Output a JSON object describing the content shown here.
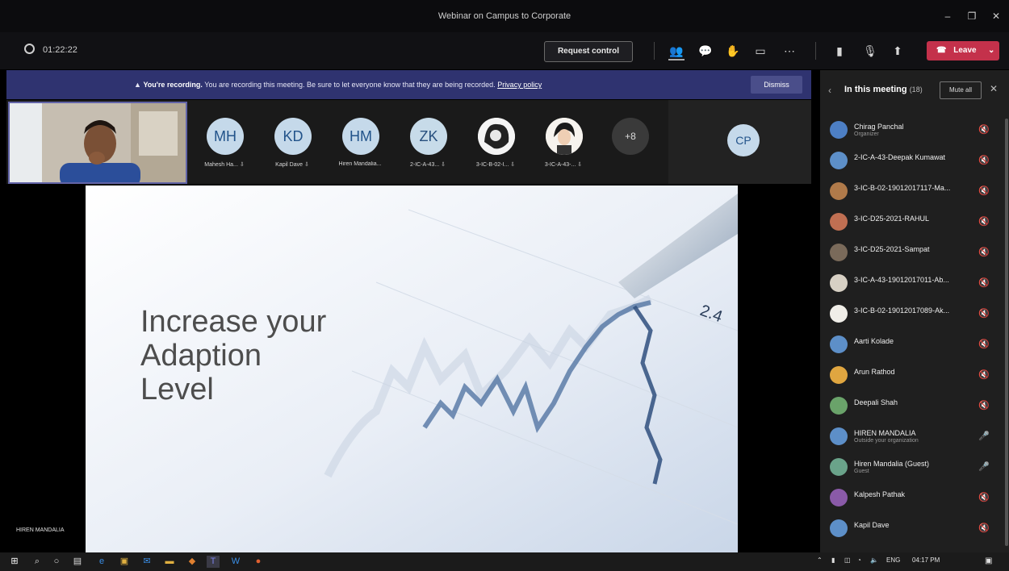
{
  "window": {
    "title": "Webinar on Campus to Corporate",
    "controls": [
      "–",
      "❐",
      "✕"
    ]
  },
  "toolbar": {
    "timer": "01:22:22",
    "request_control": "Request control",
    "leave": "Leave"
  },
  "banner": {
    "lead": "You're recording.",
    "message": "You are recording this meeting. Be sure to let everyone know that they are being recorded.",
    "link": "Privacy policy",
    "dismiss": "Dismiss"
  },
  "strip": {
    "avatars": [
      {
        "initials": "MH",
        "name": "Mahesh Ha... ⇩"
      },
      {
        "initials": "KD",
        "name": "Kapil Dave ⇩"
      },
      {
        "initials": "HM",
        "name": "Hiren Mandalia..."
      },
      {
        "initials": "ZK",
        "name": "2-IC-A-43... ⇩"
      },
      {
        "initials": "",
        "name": "3-IC-B-02-I... ⇩"
      },
      {
        "initials": "",
        "name": "3-IC-A-43-... ⇩"
      }
    ],
    "overflow": "+8",
    "cp_initials": "CP"
  },
  "slide": {
    "title": "Increase your\nAdaption\nLevel"
  },
  "presenter_label": "HIREN MANDALIA",
  "panel": {
    "title": "In this meeting",
    "count": "(18)",
    "mute_all": "Mute all",
    "participants": [
      {
        "name": "Chirag Panchal",
        "sub": "Organizer",
        "color": "#4d7fc4",
        "mic": "🔇"
      },
      {
        "name": "2-IC-A-43-Deepak Kumawat",
        "sub": "",
        "color": "#5d8fc8",
        "mic": "🔇"
      },
      {
        "name": "3-IC-B-02-19012017117-Ma...",
        "sub": "",
        "color": "#b07a4a",
        "mic": "🔇"
      },
      {
        "name": "3-IC-D25-2021-RAHUL",
        "sub": "",
        "color": "#c06f52",
        "mic": "🔇"
      },
      {
        "name": "3-IC-D25-2021-Sampat",
        "sub": "",
        "color": "#7a6a5a",
        "mic": "🔇"
      },
      {
        "name": "3-IC-A-43-19012017011-Ab...",
        "sub": "",
        "color": "#d7d0c4",
        "mic": "🔇"
      },
      {
        "name": "3-IC-B-02-19012017089-Ak...",
        "sub": "",
        "color": "#f0eee8",
        "mic": "🔇"
      },
      {
        "name": "Aarti Kolade",
        "sub": "",
        "color": "#5d8fc8",
        "mic": "🔇"
      },
      {
        "name": "Arun Rathod",
        "sub": "",
        "color": "#e0a640",
        "mic": "🔇"
      },
      {
        "name": "Deepali Shah",
        "sub": "",
        "color": "#6aa36a",
        "mic": "🔇"
      },
      {
        "name": "HIREN MANDALIA",
        "sub": "Outside your organization",
        "color": "#5d8fc8",
        "mic": "🎤"
      },
      {
        "name": "Hiren Mandalia (Guest)",
        "sub": "Guest",
        "color": "#6aa38a",
        "mic": "🎤"
      },
      {
        "name": "Kalpesh Pathak",
        "sub": "",
        "color": "#8a5aa8",
        "mic": "🔇"
      },
      {
        "name": "Kapil Dave",
        "sub": "",
        "color": "#5d8fc8",
        "mic": "🔇"
      }
    ]
  },
  "taskbar": {
    "lang": "ENG",
    "time": "04:17 PM"
  }
}
